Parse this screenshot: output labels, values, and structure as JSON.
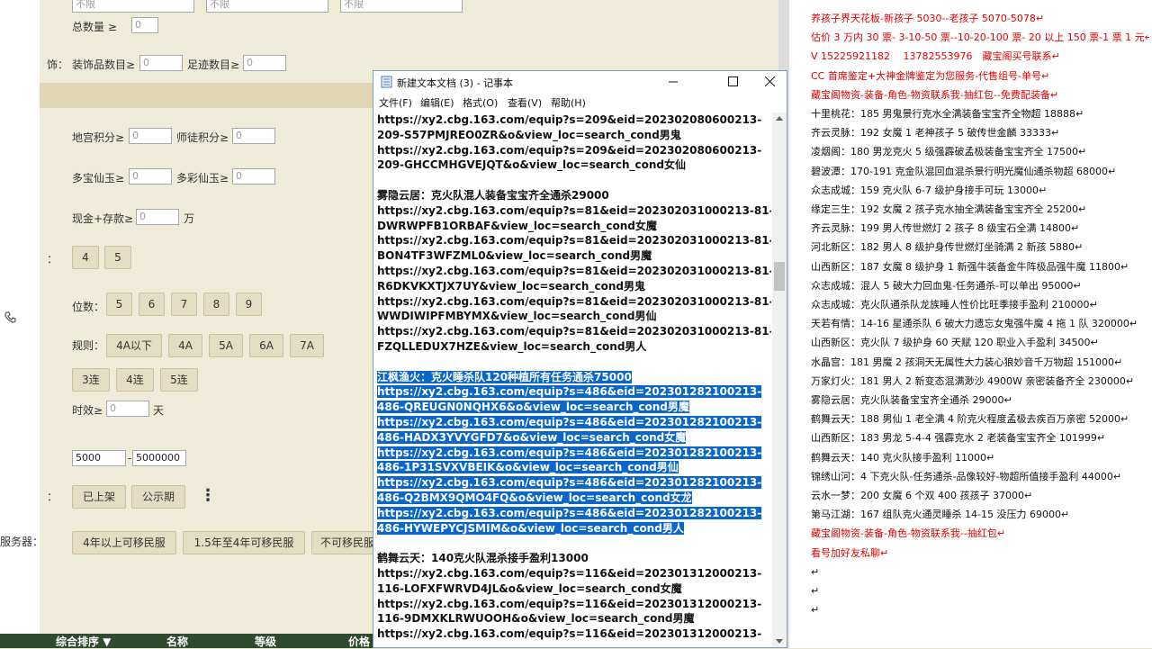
{
  "filter_panel": {
    "top_inputs": [
      "不限",
      "不限",
      "不限"
    ],
    "total_count_label": "总数量 ≥",
    "total_count_value": "0",
    "decor_prefix": "饰：",
    "decor_label": "装饰品数目≥",
    "decor_value": "0",
    "footprint_label": "足迹数目≥",
    "footprint_value": "0",
    "palace_label": "地宫积分≥",
    "palace_value": "0",
    "master_label": "师徒积分≥",
    "master_value": "0",
    "multi_jade_label": "多宝仙玉≥",
    "multi_jade_value": "0",
    "color_jade_label": "多彩仙玉≥",
    "color_jade_value": "0",
    "cash_label": "现金+存款≥",
    "cash_value": "0",
    "cash_unit": "万",
    "row_prefix": "：",
    "digit_buttons_top": [
      "4",
      "5"
    ],
    "positions_label": "位数：",
    "positions": [
      "5",
      "6",
      "7",
      "8",
      "9"
    ],
    "rule_label": "规则：",
    "rules": [
      "4A以下",
      "4A",
      "5A",
      "6A",
      "7A"
    ],
    "streaks": [
      "3连",
      "4连",
      "5连"
    ],
    "duration_label": "时效≥",
    "duration_value": "0",
    "duration_unit": "天",
    "price_min": "5000",
    "price_sep": "-",
    "price_max": "5000000",
    "status_buttons": [
      "已上架",
      "公示期"
    ],
    "more_icon": "⋮",
    "server_label": "服务器：",
    "migrate_buttons": [
      "4年以上可移民服",
      "1.5年至4年可移民服",
      "不可移民服"
    ]
  },
  "table_header": {
    "sort": "综合排序 ▼",
    "name": "名称",
    "level": "等级",
    "price": "价格"
  },
  "notepad": {
    "title": "新建文本文档 (3) - 记事本",
    "menu": [
      "文件(F)",
      "编辑(E)",
      "格式(O)",
      "查看(V)",
      "帮助(H)"
    ],
    "lines": [
      "https://xy2.cbg.163.com/equip?s=209&eid=202302080600213-",
      "209-S57PMJREO0ZR&o&view_loc=search_cond男鬼",
      "https://xy2.cbg.163.com/equip?s=209&eid=202302080600213-",
      "209-GHCCMHGVEJQT&o&view_loc=search_cond女仙",
      "",
      "雾隐云居：克火队混人装备宝宝齐全通杀29000",
      "https://xy2.cbg.163.com/equip?s=81&eid=202302031000213-81-",
      "DWRWPFB1ORBAF&view_loc=search_cond女魔",
      "https://xy2.cbg.163.com/equip?s=81&eid=202302031000213-81-",
      "BON4TF3WFZML0&view_loc=search_cond男魔",
      "https://xy2.cbg.163.com/equip?s=81&eid=202302031000213-81-",
      "R6DKVKXTJX7UY&view_loc=search_cond男鬼",
      "https://xy2.cbg.163.com/equip?s=81&eid=202302031000213-81-",
      "WWDIWIPFMBYMX&view_loc=search_cond男仙",
      "https://xy2.cbg.163.com/equip?s=81&eid=202302031000213-81-",
      "FZQLLEDUX7HZE&view_loc=search_cond男人",
      "",
      "江枫渔火：克火睡杀队120种植所有任务通杀75000",
      "https://xy2.cbg.163.com/equip?s=486&eid=202301282100213-",
      "486-QREUGN0NQHX6&o&view_loc=search_cond男魔",
      "https://xy2.cbg.163.com/equip?s=486&eid=202301282100213-",
      "486-HADX3YVYGFD7&o&view_loc=search_cond女魔",
      "https://xy2.cbg.163.com/equip?s=486&eid=202301282100213-",
      "486-1P31SVXVBEIK&o&view_loc=search_cond男仙",
      "https://xy2.cbg.163.com/equip?s=486&eid=202301282100213-",
      "486-Q2BMX9QMO4FQ&o&view_loc=search_cond女龙",
      "https://xy2.cbg.163.com/equip?s=486&eid=202301282100213-",
      "486-HYWEPYCJSMIM&o&view_loc=search_cond男人",
      "",
      "鹤舞云天：140克火队混杀接手盈利13000",
      "https://xy2.cbg.163.com/equip?s=116&eid=202301312000213-",
      "116-LOFXFWRVD4JL&o&view_loc=search_cond女魔",
      "https://xy2.cbg.163.com/equip?s=116&eid=202301312000213-",
      "116-9DMXKLRWUOOH&o&view_loc=search_cond男魔",
      "https://xy2.cbg.163.com/equip?s=116&eid=202301312000213-"
    ],
    "selected_from": 17,
    "selected_to": 27
  },
  "right_doc": {
    "lines": [
      {
        "t": "养孩子界天花板-新孩子 5030--老孩子 5070-5078↵",
        "red": true
      },
      {
        "t": "估价 3 万内 30 票- 3-10-50 票--10-20-100 票- 20 以上 150 票-1 票 1 元↵",
        "red": true
      },
      {
        "t": "V 15225921182　 13782553976　藏宝阁买号联系↵",
        "red": true
      },
      {
        "t": "CC 首席鉴定+大神金牌鉴定为您服务-代售组号-单号↵",
        "red": true
      },
      {
        "t": "藏宝阁物资-装备-角色-物资联系我-抽红包--免费配装备↵",
        "red": true
      },
      {
        "t": "十里桃花：185 男鬼景行克水全满装备宝宝齐全物超 18888↵",
        "red": false
      },
      {
        "t": "齐云灵脉：192 女魔 1 老神孩子 5 破传世金麟 33333↵",
        "red": false
      },
      {
        "t": "凌烟阁：180 男龙克火 5 级强霹破孟极装备宝宝齐全 17500↵",
        "red": false
      },
      {
        "t": "碧波潭：170-191 克金队混回血混杀景行明光魔仙通杀物超 68000↵",
        "red": false
      },
      {
        "t": "众志成城：159 克火队 6-7 级护身接手可玩 13000↵",
        "red": false
      },
      {
        "t": "缘定三生：192 女魔 2 孩子克水抽全满装备宝宝齐全 25200↵",
        "red": false
      },
      {
        "t": "齐云灵脉：199 男人传世燃灯 2 孩子 8 级宝石全满 14800↵",
        "red": false
      },
      {
        "t": "河北新区：182 男人 8 级护身传世燃灯坐骑满 2 新孩 5880↵",
        "red": false
      },
      {
        "t": "山西新区：187 女魔 8 级护身 1 新强牛装备金牛阵极品强牛魔 11800↵",
        "red": false
      },
      {
        "t": "众志成城：混人 5 破大力回血鬼-任务通杀-可以单出 95000↵",
        "red": false
      },
      {
        "t": "众志成城：克火队通杀队龙族睡人性价比旺季接手盈利 210000↵",
        "red": false
      },
      {
        "t": "天若有情：14-16 星通杀队 6 破大力遗忘女鬼强牛魔 4 拖 1 队 320000↵",
        "red": false
      },
      {
        "t": "山西新区：克火队 7 级护身 60 天赋 120 职业入手盈利 34500↵",
        "red": false
      },
      {
        "t": "水晶宫：181 男魔 2 孩洞天无属性大力装心狼妙音千万物超 151000↵",
        "red": false
      },
      {
        "t": "万家灯火：181 男人 2 新变态混满渺沙 4900W 亲密装备齐全 230000↵",
        "red": false
      },
      {
        "t": "雾隐云居：克火队装备宝宝齐全通杀 29000↵",
        "red": false
      },
      {
        "t": "鹤舞云天：188 男仙 1 老全满 4 阶克火程度孟极去疾百万亲密 52000↵",
        "red": false
      },
      {
        "t": "山西新区：183 男龙 5-4-4 强霹克水 2 老装备宝宝齐全 101999↵",
        "red": false
      },
      {
        "t": "鹤舞云天：140 克火队接手盈利 11000↵",
        "red": false
      },
      {
        "t": "锦绣山河：4 下克火队-任务通杀-品像较好-物超所值接手盈利 44000↵",
        "red": false
      },
      {
        "t": "云水一梦：200 女魔 6 个双 400 孩孩子 37000↵",
        "red": false
      },
      {
        "t": "第马江湖：167 组队克火通灵睡杀 14-15 没压力 69000↵",
        "red": false
      },
      {
        "t": "藏宝阁物资-装备-角色-物资联系我--抽红包↵",
        "red": true
      },
      {
        "t": "看号加好友私聊↵",
        "red": true
      },
      {
        "t": "↵",
        "red": false
      },
      {
        "t": "↵",
        "red": false
      },
      {
        "t": "↵",
        "red": false
      }
    ]
  },
  "colors": {
    "accent_red": "#e00000",
    "selection": "#0a66c8",
    "panel_bg": "#efebd9",
    "header_green": "#2f4b2d"
  }
}
